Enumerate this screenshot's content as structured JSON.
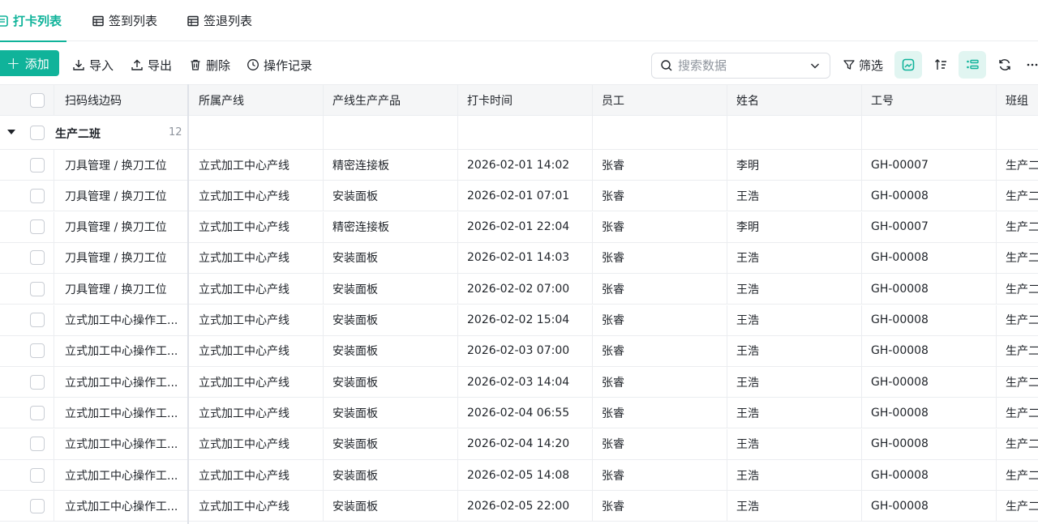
{
  "tabs": [
    {
      "label": "打卡列表",
      "active": true
    },
    {
      "label": "签到列表",
      "active": false
    },
    {
      "label": "签退列表",
      "active": false
    }
  ],
  "toolbar": {
    "add_label": "添加",
    "import_label": "导入",
    "export_label": "导出",
    "delete_label": "删除",
    "log_label": "操作记录",
    "search_placeholder": "搜索数据",
    "filter_label": "筛选"
  },
  "colors": {
    "accent": "#10b39a",
    "accent_light": "#e1f5f1"
  },
  "table": {
    "columns": [
      "扫码线边码",
      "所属产线",
      "产线生产产品",
      "打卡时间",
      "员工",
      "姓名",
      "工号",
      "班组"
    ],
    "group": {
      "name": "生产二班",
      "count": "12"
    },
    "rows": [
      [
        "刀具管理 / 换刀工位",
        "立式加工中心产线",
        "精密连接板",
        "2026-02-01 14:02",
        "张睿",
        "李明",
        "GH-00007",
        "生产二"
      ],
      [
        "刀具管理 / 换刀工位",
        "立式加工中心产线",
        "安装面板",
        "2026-02-01 07:01",
        "张睿",
        "王浩",
        "GH-00008",
        "生产二"
      ],
      [
        "刀具管理 / 换刀工位",
        "立式加工中心产线",
        "精密连接板",
        "2026-02-01 22:04",
        "张睿",
        "李明",
        "GH-00007",
        "生产二"
      ],
      [
        "刀具管理 / 换刀工位",
        "立式加工中心产线",
        "安装面板",
        "2026-02-01 14:03",
        "张睿",
        "王浩",
        "GH-00008",
        "生产二"
      ],
      [
        "刀具管理 / 换刀工位",
        "立式加工中心产线",
        "安装面板",
        "2026-02-02 07:00",
        "张睿",
        "王浩",
        "GH-00008",
        "生产二"
      ],
      [
        "立式加工中心操作工...",
        "立式加工中心产线",
        "安装面板",
        "2026-02-02 15:04",
        "张睿",
        "王浩",
        "GH-00008",
        "生产二"
      ],
      [
        "立式加工中心操作工...",
        "立式加工中心产线",
        "安装面板",
        "2026-02-03 07:00",
        "张睿",
        "王浩",
        "GH-00008",
        "生产二"
      ],
      [
        "立式加工中心操作工...",
        "立式加工中心产线",
        "安装面板",
        "2026-02-03 14:04",
        "张睿",
        "王浩",
        "GH-00008",
        "生产二"
      ],
      [
        "立式加工中心操作工...",
        "立式加工中心产线",
        "安装面板",
        "2026-02-04 06:55",
        "张睿",
        "王浩",
        "GH-00008",
        "生产二"
      ],
      [
        "立式加工中心操作工...",
        "立式加工中心产线",
        "安装面板",
        "2026-02-04 14:20",
        "张睿",
        "王浩",
        "GH-00008",
        "生产二"
      ],
      [
        "立式加工中心操作工...",
        "立式加工中心产线",
        "安装面板",
        "2026-02-05 14:08",
        "张睿",
        "王浩",
        "GH-00008",
        "生产二"
      ],
      [
        "立式加工中心操作工...",
        "立式加工中心产线",
        "安装面板",
        "2026-02-05 22:00",
        "张睿",
        "王浩",
        "GH-00008",
        "生产二"
      ]
    ]
  }
}
